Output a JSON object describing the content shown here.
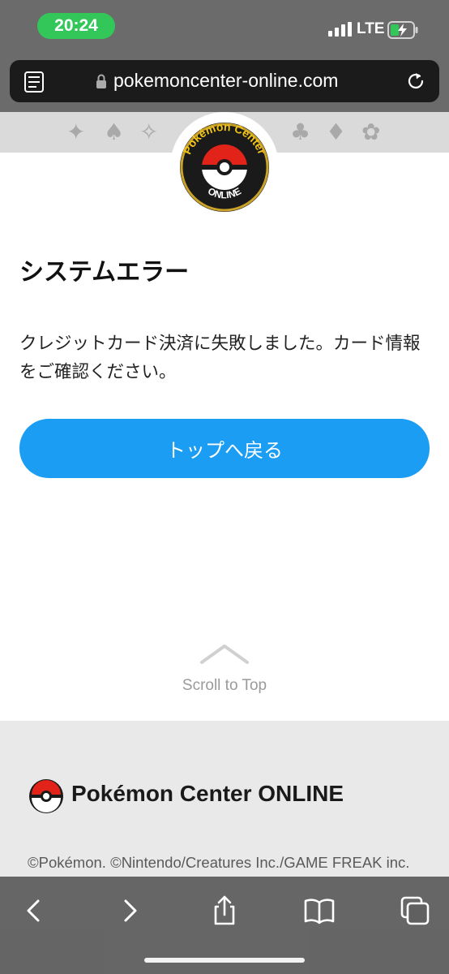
{
  "status_bar": {
    "time": "20:24",
    "network": "LTE",
    "accent_color": "#33c759"
  },
  "browser": {
    "url": "pokemoncenter-online.com",
    "icons": [
      "reader-icon",
      "lock-icon",
      "reload-icon"
    ]
  },
  "page": {
    "title": "システムエラー",
    "message": "クレジットカード決済に失敗しました。カード情報をご確認ください。",
    "back_button": "トップへ戻る",
    "scroll_to_top": "Scroll to Top",
    "button_color": "#1a9df2"
  },
  "logo": {
    "line1": "Pokémon",
    "line2": "Center",
    "line3": "ONLINE"
  },
  "footer": {
    "brand": "Pokémon Center ONLINE",
    "copyright": "©Pokémon. ©Nintendo/Creatures Inc./GAME FREAK inc."
  },
  "toolbar": {
    "icons": [
      "back-icon",
      "forward-icon",
      "share-icon",
      "bookmarks-icon",
      "tabs-icon"
    ]
  }
}
